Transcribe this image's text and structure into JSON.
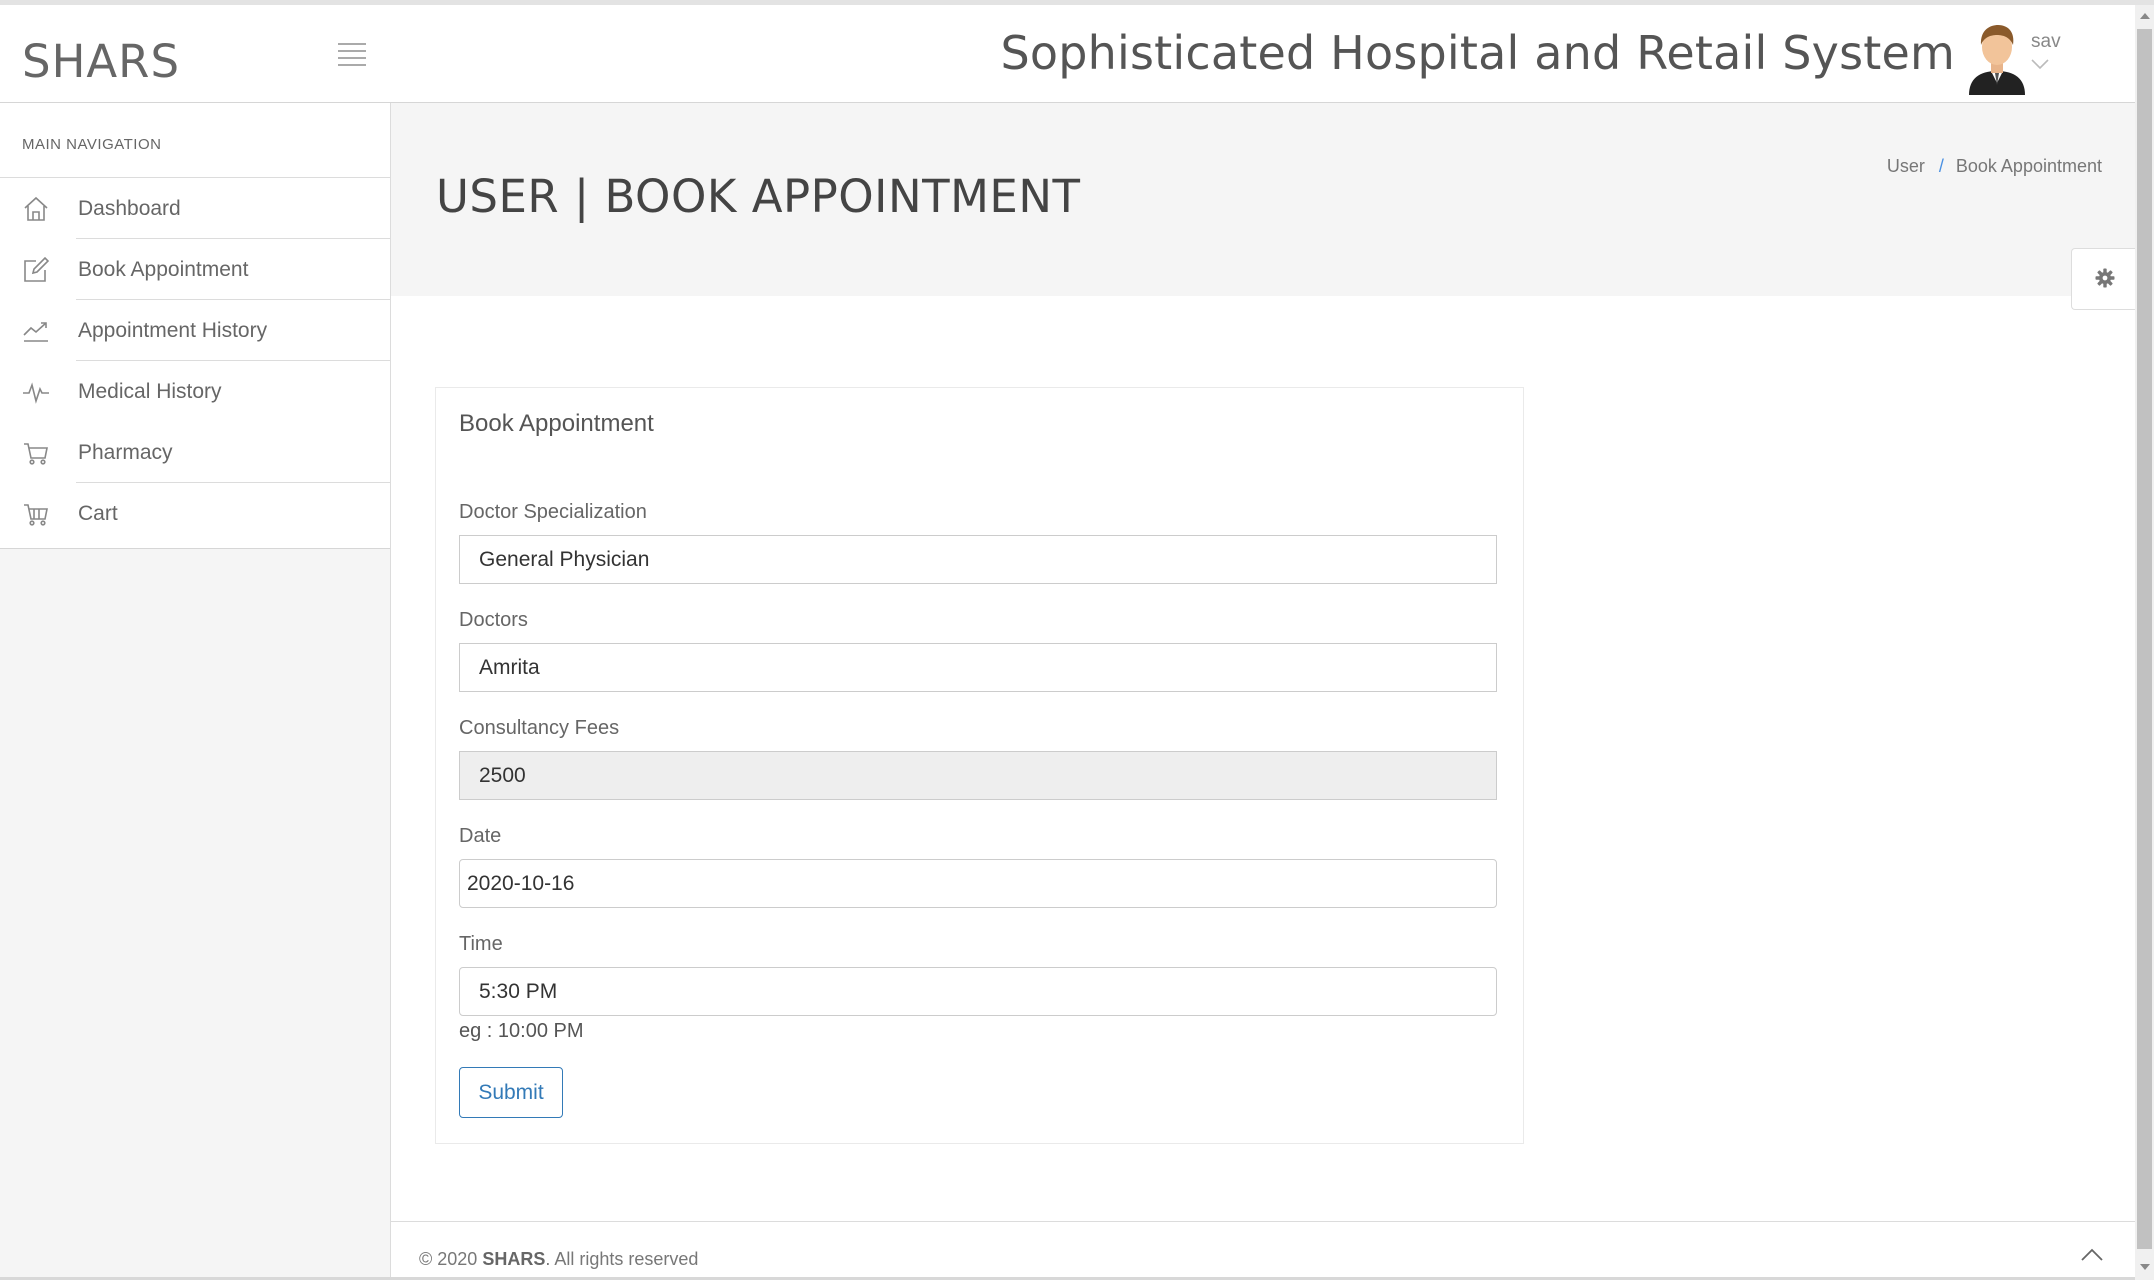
{
  "app": {
    "brand": "SHARS",
    "title": "Sophisticated Hospital and Retail System"
  },
  "user": {
    "name": "sav"
  },
  "sidebar": {
    "header": "MAIN NAVIGATION",
    "items": [
      {
        "label": "Dashboard",
        "icon": "home-icon"
      },
      {
        "label": "Book Appointment",
        "icon": "edit-icon"
      },
      {
        "label": "Appointment History",
        "icon": "trend-chart-icon"
      },
      {
        "label": "Medical History",
        "icon": "pulse-icon"
      },
      {
        "label": "Pharmacy",
        "icon": "cart-icon"
      },
      {
        "label": "Cart",
        "icon": "cart-icon"
      }
    ]
  },
  "page": {
    "title": "USER | BOOK APPOINTMENT",
    "breadcrumb": {
      "parent": "User",
      "separator": "/",
      "current": "Book Appointment"
    }
  },
  "form": {
    "title": "Book Appointment",
    "specialization": {
      "label": "Doctor Specialization",
      "value": "General Physician"
    },
    "doctor": {
      "label": "Doctors",
      "value": "Amrita"
    },
    "fees": {
      "label": "Consultancy Fees",
      "value": "2500"
    },
    "date": {
      "label": "Date",
      "value": "2020-10-16"
    },
    "time": {
      "label": "Time",
      "value": "5:30 PM",
      "hint": "eg : 10:00 PM"
    },
    "submit_label": "Submit"
  },
  "footer": {
    "prefix": "© 2020",
    "brand": "SHARS",
    "suffix": ". All rights reserved"
  },
  "colors": {
    "accent": "#337ab7",
    "breadcrumb_separator": "#4a90e2",
    "sidebar_bg": "#f5f5f5"
  }
}
